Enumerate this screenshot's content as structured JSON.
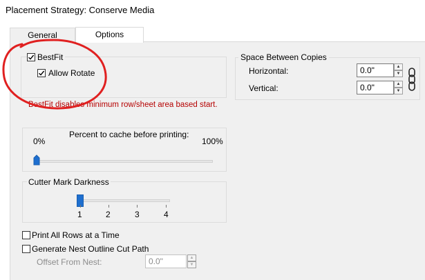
{
  "window": {
    "title": "Placement Strategy: Conserve Media"
  },
  "tabs": [
    {
      "label": "General",
      "active": false
    },
    {
      "label": "Options",
      "active": true
    }
  ],
  "bestfit": {
    "label": "BestFit",
    "checked": true,
    "allow_rotate_label": "Allow Rotate",
    "allow_rotate_checked": true,
    "note": "BestFit disables minimum row/sheet area based start."
  },
  "spacing": {
    "title": "Space Between Copies",
    "horizontal_label": "Horizontal:",
    "horizontal_value": "0.0\"",
    "vertical_label": "Vertical:",
    "vertical_value": "0.0\"",
    "link_icon": "chain-link-icon"
  },
  "cache": {
    "label": "Percent to cache before printing:",
    "min_label": "0%",
    "max_label": "100%",
    "value_percent": 0
  },
  "cutter": {
    "title": "Cutter Mark Darkness",
    "ticks": [
      "1",
      "2",
      "3",
      "4"
    ],
    "value": 1
  },
  "print_all_rows": {
    "label": "Print All Rows at a Time",
    "checked": false
  },
  "nest_outline": {
    "label": "Generate Nest Outline Cut Path",
    "checked": false
  },
  "offset": {
    "label": "Offset From Nest:",
    "value": "0.0\""
  },
  "annotation": {
    "color": "#e02020",
    "shape": "red-circle-annotation"
  },
  "colors": {
    "slider_thumb": "#1e6fcf",
    "note_text": "#b50000"
  }
}
